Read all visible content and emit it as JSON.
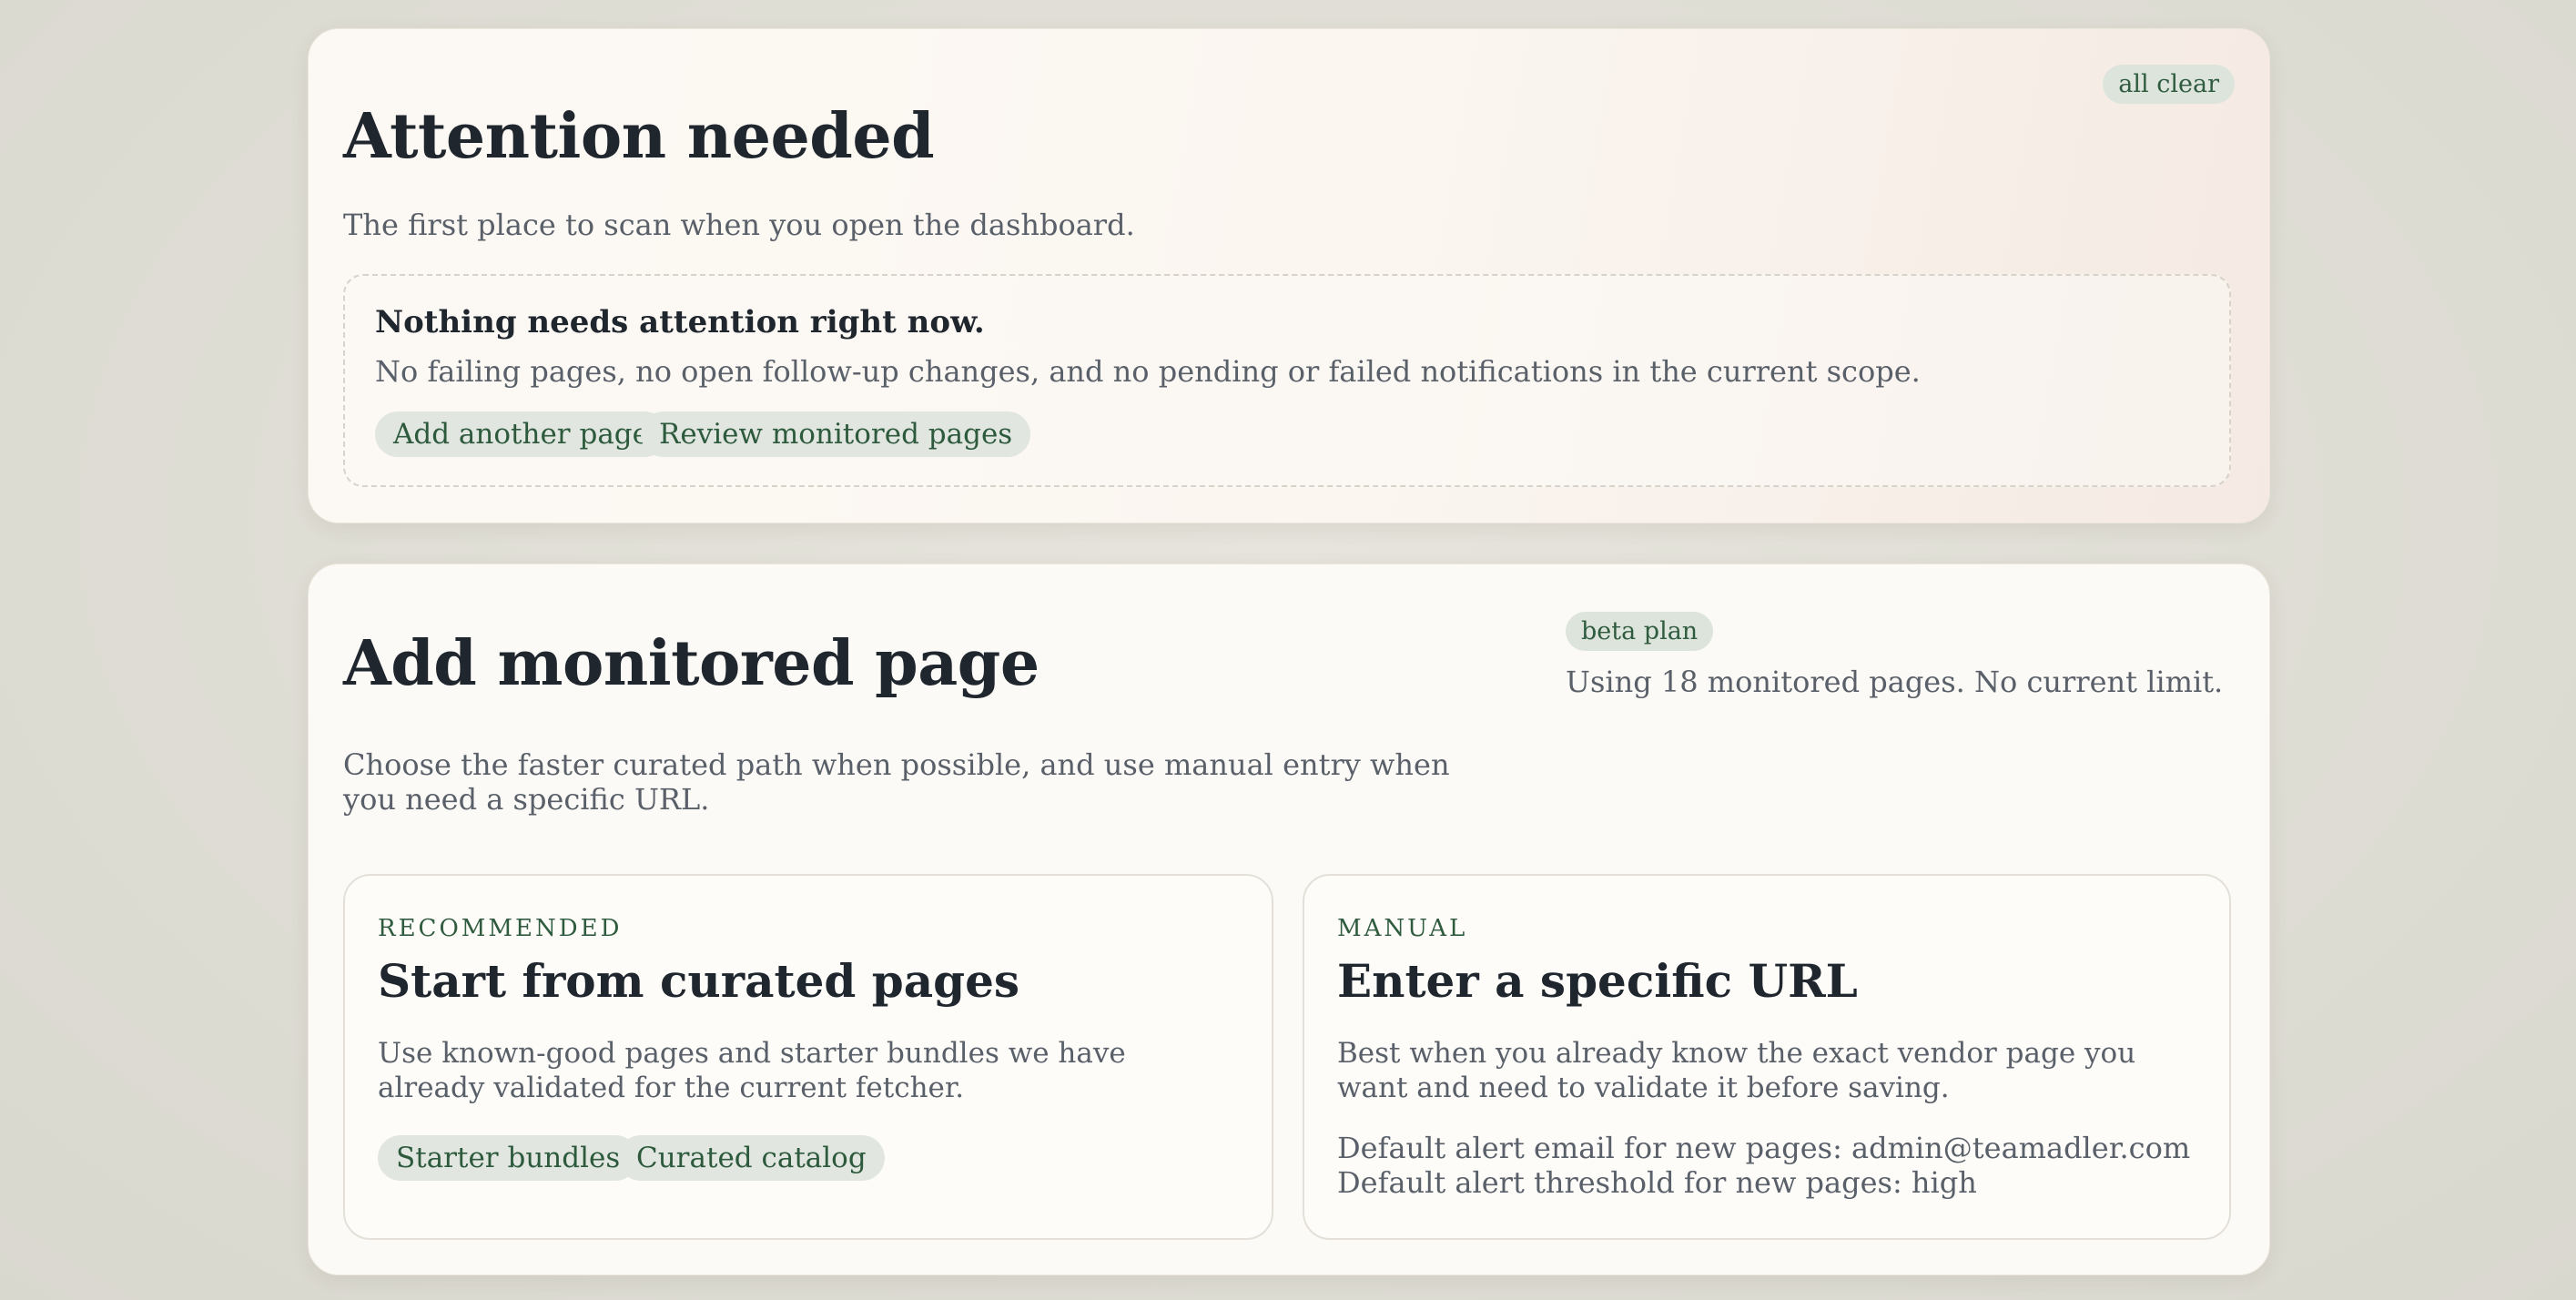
{
  "attention": {
    "badge": "all clear",
    "title": "Attention needed",
    "subtitle": "The first place to scan when you open the dashboard.",
    "empty_state": {
      "title": "Nothing needs attention right now.",
      "text": "No failing pages, no open follow-up changes, and no pending or failed notifications in the current scope.",
      "actions": [
        {
          "label": "Add another page"
        },
        {
          "label": "Review monitored pages"
        }
      ]
    }
  },
  "add_page": {
    "title": "Add monitored page",
    "subtitle": "Choose the faster curated path when possible, and use manual entry when you need a specific URL.",
    "plan_badge": "beta plan",
    "usage_text": "Using 18 monitored pages. No current limit.",
    "curated": {
      "eyebrow": "RECOMMENDED",
      "title": "Start from curated pages",
      "text": "Use known-good pages and starter bundles we have already validated for the current fetcher.",
      "actions": [
        {
          "label": "Starter bundles"
        },
        {
          "label": "Curated catalog"
        }
      ]
    },
    "manual": {
      "eyebrow": "MANUAL",
      "title": "Enter a specific URL",
      "text": "Best when you already know the exact vendor page you want and need to validate it before saving.",
      "default_email": "Default alert email for new pages: admin@teamadler.com",
      "default_threshold": "Default alert threshold for new pages: high"
    }
  }
}
